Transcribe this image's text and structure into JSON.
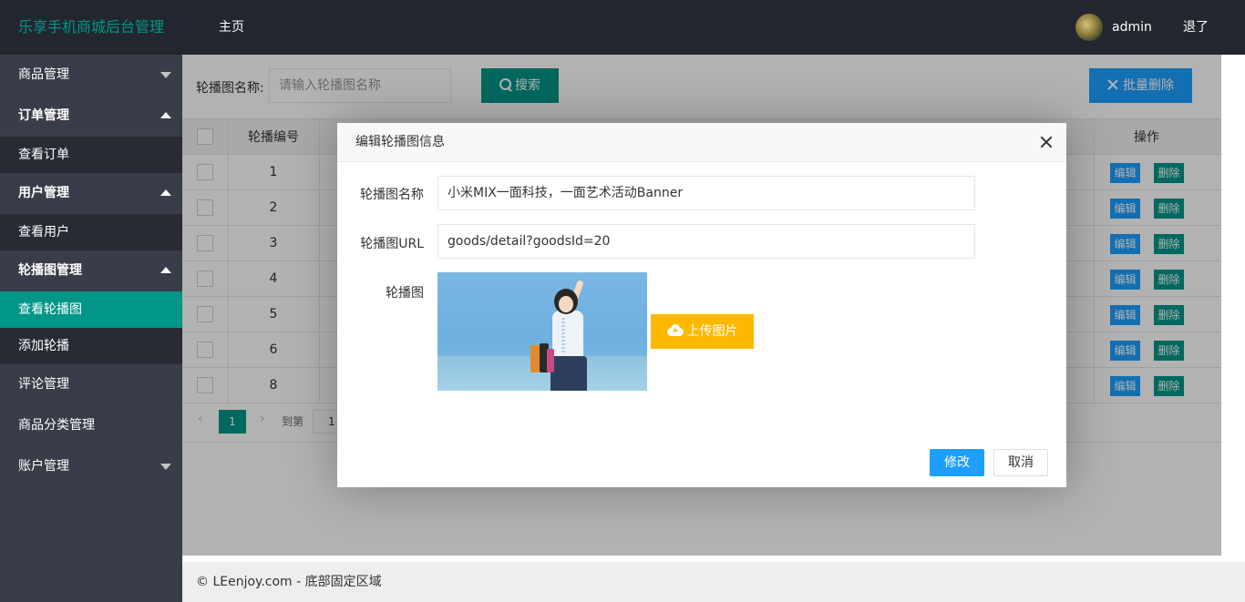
{
  "header": {
    "logo": "乐享手机商城后台管理",
    "home": "主页",
    "user": "admin",
    "logout": "退了"
  },
  "sidebar": {
    "items": [
      {
        "label": "商品管理"
      },
      {
        "label": "订单管理"
      },
      {
        "label": "查看订单"
      },
      {
        "label": "用户管理"
      },
      {
        "label": "查看用户"
      },
      {
        "label": "轮播图管理"
      },
      {
        "label": "查看轮播图"
      },
      {
        "label": "添加轮播"
      },
      {
        "label": "评论管理"
      },
      {
        "label": "商品分类管理"
      },
      {
        "label": "账户管理"
      }
    ]
  },
  "search": {
    "label": "轮播图名称:",
    "placeholder": "请输入轮播图名称",
    "button": "搜索",
    "batch_delete": "批量删除"
  },
  "table": {
    "col_no": "轮播编号",
    "col_op": "操作",
    "edit": "编辑",
    "delete": "删除",
    "rows": [
      "1",
      "2",
      "3",
      "4",
      "5",
      "6",
      "8"
    ]
  },
  "pager": {
    "current": "1",
    "goto": "到第",
    "input": "1"
  },
  "footer": "© LEenjoy.com - 底部固定区域",
  "modal": {
    "title": "编辑轮播图信息",
    "name_label": "轮播图名称",
    "name_value": "小米MIX一面科技，一面艺术活动Banner",
    "url_label": "轮播图URL",
    "url_value": "goods/detail?goodsId=20",
    "image_label": "轮播图",
    "upload": "上传图片",
    "submit": "修改",
    "cancel": "取消"
  }
}
